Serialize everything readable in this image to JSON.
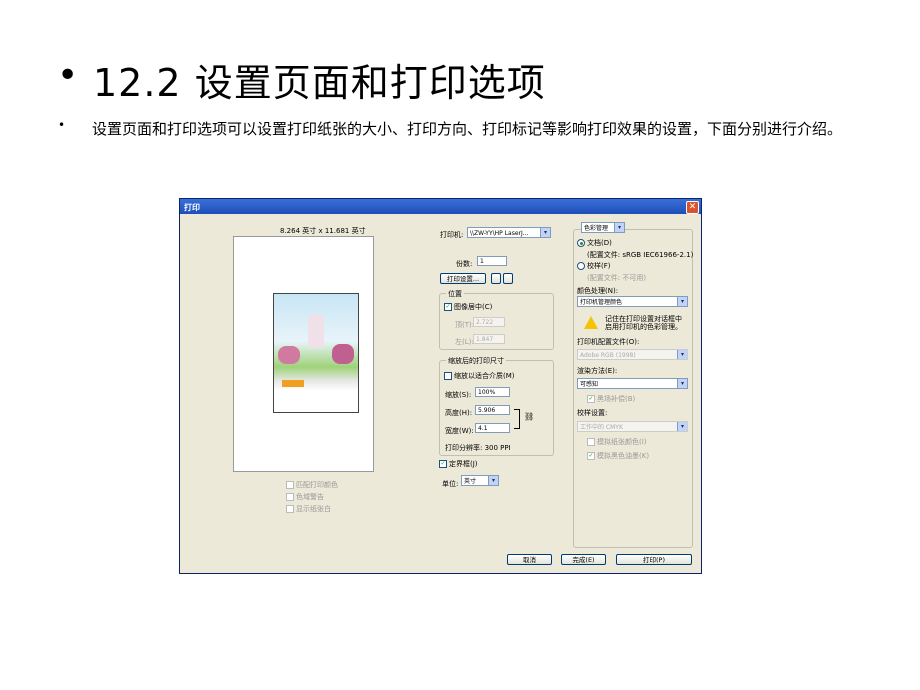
{
  "slide": {
    "bullet": "•",
    "title": "12.2  设置页面和打印选项",
    "sub_bullet": "•",
    "subtitle": "设置页面和打印选项可以设置打印纸张的大小、打印方向、打印标记等影响打印效果的设置，下面分别进行介绍。"
  },
  "dialog": {
    "title": "打印",
    "close": "✕",
    "paper_size": "8.264 英寸 x 11.681 英寸",
    "left_options": [
      "匹配打印颜色",
      "色域警告",
      "显示纸张白"
    ],
    "printer_label": "打印机:",
    "printer_value": "\\\\ZW-YY\\HP LaserJ...",
    "copies_label": "份数:",
    "copies_value": "1",
    "page_setup_button": "打印设置...",
    "position_group": "位置",
    "center_image": "图像居中(C)",
    "top_label": "顶(T):",
    "top_value": "2.722",
    "left_label": "左(L):",
    "left_value": "1.847",
    "scaled_group": "缩放后的打印尺寸",
    "fit_media": "缩放以适合介质(M)",
    "scale_label": "缩放(S):",
    "scale_value": "100%",
    "height_label": "高度(H):",
    "height_value": "5.906",
    "width_label": "宽度(W):",
    "width_value": "4.1",
    "resolution": "打印分辨率: 300 PPI",
    "bounding_box": "定界框(J)",
    "unit_label": "单位:",
    "unit_value": "英寸",
    "color_mgmt": "色彩管理",
    "document_radio": "文档(D)",
    "doc_profile": "(配置文件: sRGB IEC61966-2.1)",
    "proof_radio": "校样(F)",
    "proof_profile": "(配置文件: 不可用)",
    "color_handling_label": "颜色处理(N):",
    "color_handling_value": "打印机管理颜色",
    "warning_text": "记住在打印设置对话框中启用打印机的色彩管理。",
    "printer_profile_label": "打印机配置文件(O):",
    "printer_profile_value": "Adobe RGB (1998)",
    "intent_label": "渲染方法(E):",
    "intent_value": "可感知",
    "bpc": "黑场补偿(B)",
    "proof_setup_label": "校样设置:",
    "proof_setup_value": "工作中的 CMYK",
    "sim_paper": "模拟纸张颜色(I)",
    "sim_black": "模拟黑色油墨(K)",
    "cancel": "取消",
    "done": "完成(E)",
    "print": "打印(P)"
  }
}
